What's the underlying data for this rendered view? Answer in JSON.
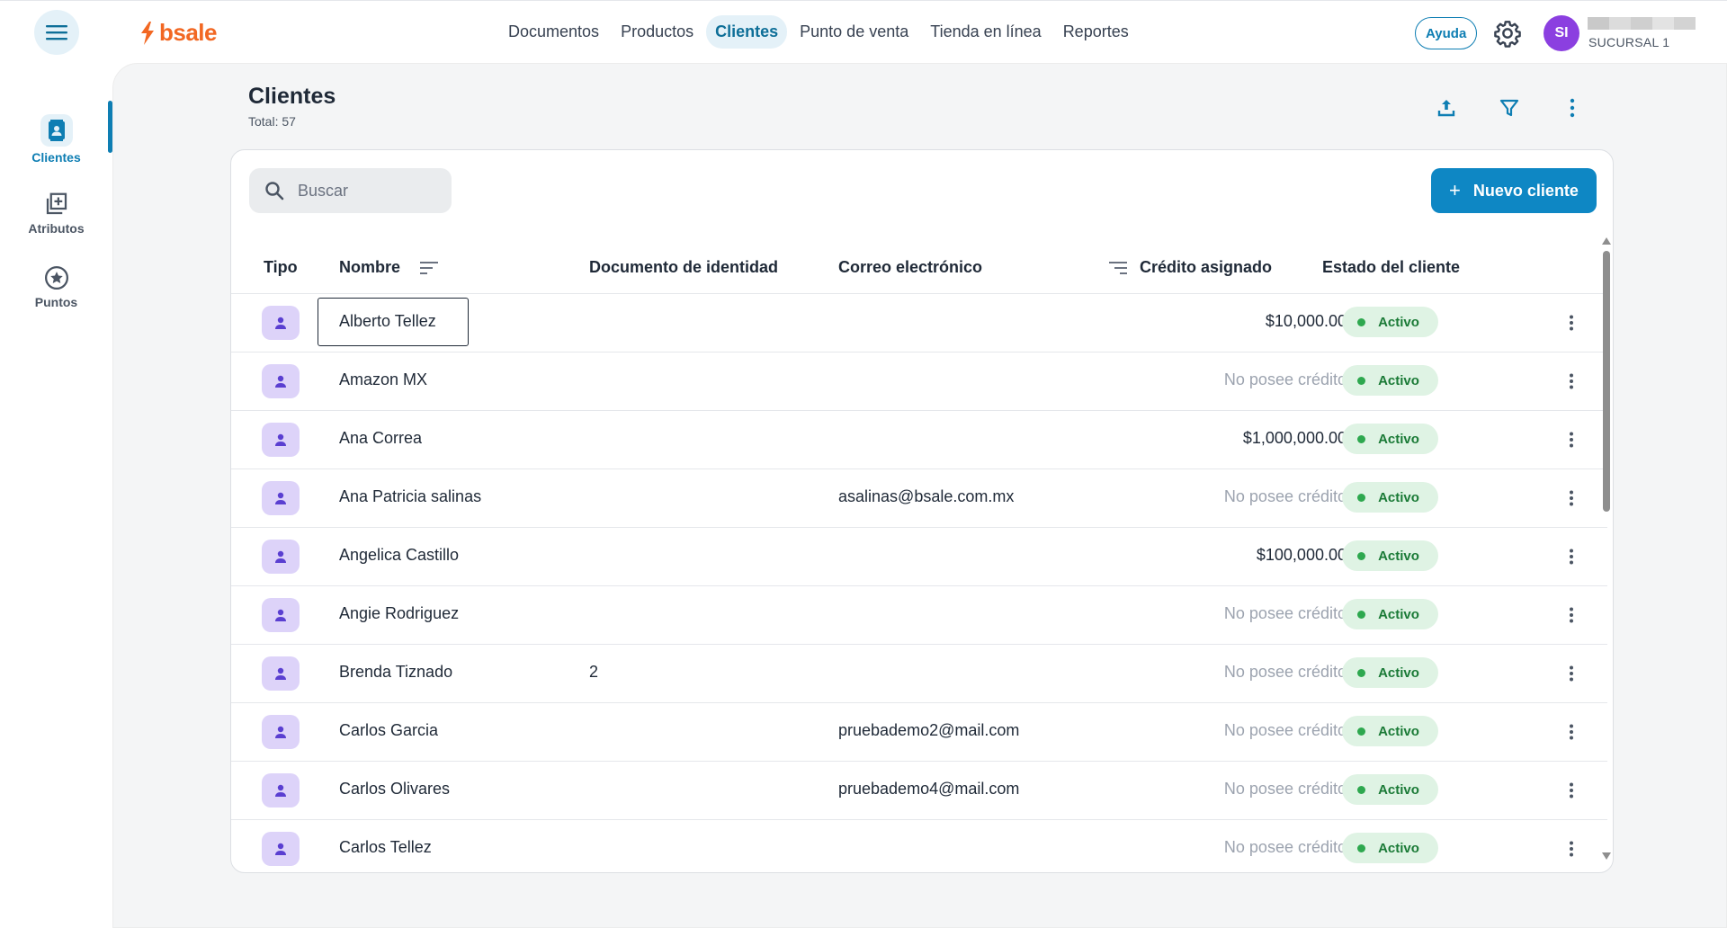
{
  "app": {
    "logo_text": "bsale",
    "brand_color": "#f26722",
    "accent_color": "#0e87c4"
  },
  "topnav": {
    "items": [
      {
        "label": "Documentos",
        "active": false
      },
      {
        "label": "Productos",
        "active": false
      },
      {
        "label": "Clientes",
        "active": true
      },
      {
        "label": "Punto de venta",
        "active": false
      },
      {
        "label": "Tienda en línea",
        "active": false
      },
      {
        "label": "Reportes",
        "active": false
      }
    ],
    "help_label": "Ayuda",
    "avatar_initials": "SI",
    "branch": "SUCURSAL 1"
  },
  "sidebar": {
    "items": [
      {
        "label": "Clientes",
        "icon": "contact-book-icon",
        "active": true
      },
      {
        "label": "Atributos",
        "icon": "library-add-icon",
        "active": false
      },
      {
        "label": "Puntos",
        "icon": "star-circle-icon",
        "active": false
      }
    ]
  },
  "page": {
    "title": "Clientes",
    "total": "Total: 57"
  },
  "toolbar": {
    "search_placeholder": "Buscar",
    "new_button_label": "Nuevo cliente",
    "new_button_icon": "+"
  },
  "table": {
    "headers": {
      "tipo": "Tipo",
      "nombre": "Nombre",
      "documento": "Documento de identidad",
      "correo": "Correo electrónico",
      "credito": "Crédito asignado",
      "estado": "Estado del cliente"
    },
    "rows": [
      {
        "name": "Alberto Tellez",
        "doc": "",
        "email": "",
        "credit": "$10,000.00",
        "has_credit": true,
        "status": "Activo"
      },
      {
        "name": "Amazon MX",
        "doc": "",
        "email": "",
        "credit": "No posee crédito",
        "has_credit": false,
        "status": "Activo"
      },
      {
        "name": "Ana Correa",
        "doc": "",
        "email": "",
        "credit": "$1,000,000.00",
        "has_credit": true,
        "status": "Activo"
      },
      {
        "name": "Ana Patricia salinas",
        "doc": "",
        "email": "asalinas@bsale.com.mx",
        "credit": "No posee crédito",
        "has_credit": false,
        "status": "Activo"
      },
      {
        "name": "Angelica Castillo",
        "doc": "",
        "email": "",
        "credit": "$100,000.00",
        "has_credit": true,
        "status": "Activo"
      },
      {
        "name": "Angie Rodriguez",
        "doc": "",
        "email": "",
        "credit": "No posee crédito",
        "has_credit": false,
        "status": "Activo"
      },
      {
        "name": "Brenda Tiznado",
        "doc": "2",
        "email": "",
        "credit": "No posee crédito",
        "has_credit": false,
        "status": "Activo"
      },
      {
        "name": "Carlos Garcia",
        "doc": "",
        "email": "pruebademo2@mail.com",
        "credit": "No posee crédito",
        "has_credit": false,
        "status": "Activo"
      },
      {
        "name": "Carlos Olivares",
        "doc": "",
        "email": "pruebademo4@mail.com",
        "credit": "No posee crédito",
        "has_credit": false,
        "status": "Activo"
      },
      {
        "name": "Carlos Tellez",
        "doc": "",
        "email": "",
        "credit": "No posee crédito",
        "has_credit": false,
        "status": "Activo"
      }
    ]
  }
}
